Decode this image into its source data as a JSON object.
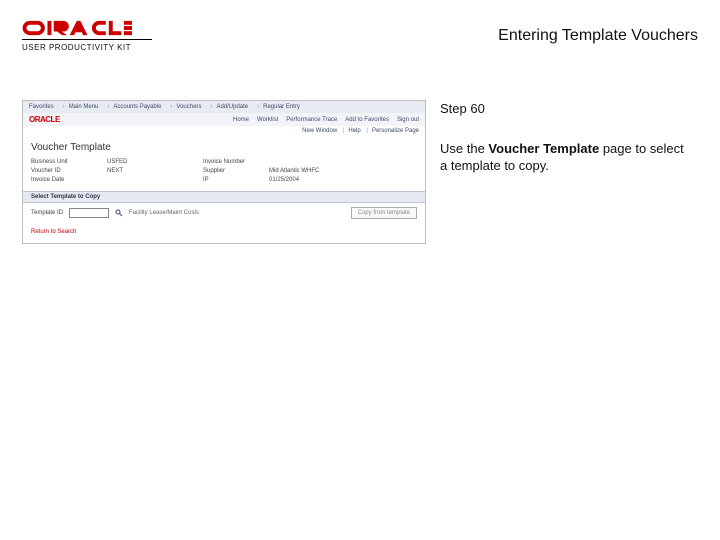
{
  "doc": {
    "title": "Entering Template Vouchers",
    "brand_upk": "USER PRODUCTIVITY KIT"
  },
  "right": {
    "step": "Step 60",
    "instr_pre": "Use the ",
    "instr_strong": "Voucher Template",
    "instr_post": " page to select a template to copy."
  },
  "shot": {
    "breadcrumb": [
      "Favorites",
      "Main Menu",
      "Accounts Payable",
      "Vouchers",
      "Add/Update",
      "Regular Entry"
    ],
    "nav_logo": "ORACLE",
    "nav_links": [
      "Home",
      "Worklist",
      "Performance Trace",
      "Add to Favorites",
      "Sign out"
    ],
    "sub_items": [
      "New Window",
      "Help",
      "Personalize Page"
    ],
    "page_title": "Voucher Template",
    "fields": {
      "bu_label": "Business Unit",
      "bu_value": "USFED",
      "inv_label": "Invoice Number",
      "inv_value": "",
      "vid_label": "Voucher ID",
      "vid_value": "NEXT",
      "supplier_label": "Supplier",
      "supplier_value": "Mid Atlantic WHFC",
      "invdate_label": "Invoice Date",
      "invdate_value": "",
      "ip_label": "IP",
      "ip_value": "01/25/2004"
    },
    "section_header": "Select Template to Copy",
    "select": {
      "label": "Template ID",
      "hint": "Facility Lease/Maint Costs",
      "button": "Copy from template"
    },
    "bottom_link": "Return to Search"
  }
}
